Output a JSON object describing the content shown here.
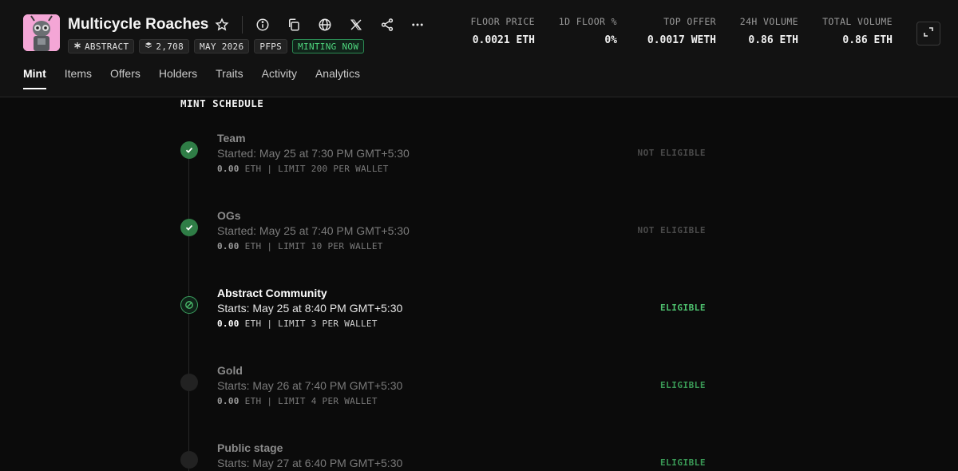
{
  "collection": {
    "title": "Multicycle Roaches",
    "chips": {
      "chain": "ABSTRACT",
      "supply": "2,708",
      "date": "MAY 2026",
      "category": "PFPS",
      "status": "MINTING NOW"
    }
  },
  "stats": [
    {
      "label": "FLOOR PRICE",
      "value": "0.0021 ETH"
    },
    {
      "label": "1D FLOOR %",
      "value": "0%"
    },
    {
      "label": "TOP OFFER",
      "value": "0.0017 WETH"
    },
    {
      "label": "24H VOLUME",
      "value": "0.86 ETH"
    },
    {
      "label": "TOTAL VOLUME",
      "value": "0.86 ETH"
    }
  ],
  "tabs": [
    {
      "label": "Mint",
      "active": true
    },
    {
      "label": "Items"
    },
    {
      "label": "Offers"
    },
    {
      "label": "Holders"
    },
    {
      "label": "Traits"
    },
    {
      "label": "Activity"
    },
    {
      "label": "Analytics"
    }
  ],
  "schedule": {
    "title": "MINT SCHEDULE",
    "stages": [
      {
        "name": "Team",
        "time": "Started: May 25 at 7:30 PM GMT+5:30",
        "price": "0.00",
        "details": "ETH | LIMIT 200 PER WALLET",
        "status": "NOT ELIGIBLE"
      },
      {
        "name": "OGs",
        "time": "Started: May 25 at 7:40 PM GMT+5:30",
        "price": "0.00",
        "details": "ETH | LIMIT 10 PER WALLET",
        "status": "NOT ELIGIBLE"
      },
      {
        "name": "Abstract Community",
        "time": "Starts: May 25 at 8:40 PM GMT+5:30",
        "price": "0.00",
        "details": "ETH | LIMIT 3 PER WALLET",
        "status": "ELIGIBLE"
      },
      {
        "name": "Gold",
        "time": "Starts: May 26 at 7:40 PM GMT+5:30",
        "price": "0.00",
        "details": "ETH | LIMIT 4 PER WALLET",
        "status": "ELIGIBLE"
      },
      {
        "name": "Public stage",
        "time": "Starts: May 27 at 6:40 PM GMT+5:30",
        "status": "ELIGIBLE"
      }
    ]
  },
  "colors": {
    "accent_green": "#4fc470",
    "background": "#0b0b0b",
    "header": "#121212"
  }
}
